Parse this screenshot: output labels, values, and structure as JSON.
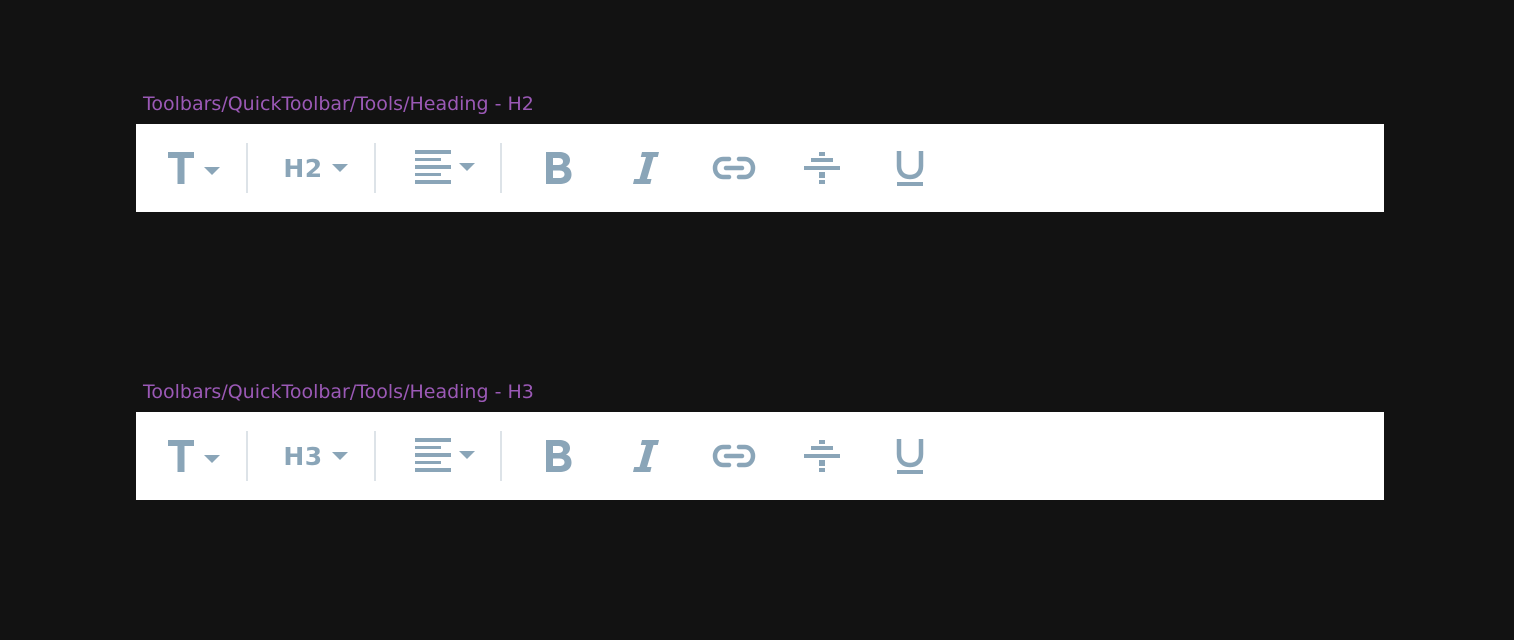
{
  "colors": {
    "background": "#121212",
    "toolbar_bg": "#ffffff",
    "icon": "#8aa5b8",
    "separator": "#dde3e8",
    "frame_label": "#9b59b6"
  },
  "frames": [
    {
      "label": "Toolbars/QuickToolbar/Tools/Heading - H2",
      "heading_value": "H2",
      "tools": [
        "text-type-icon",
        "heading-dropdown",
        "align-left-icon",
        "bold-icon",
        "italic-icon",
        "link-icon",
        "strikethrough-icon",
        "underline-icon"
      ]
    },
    {
      "label": "Toolbars/QuickToolbar/Tools/Heading - H3",
      "heading_value": "H3",
      "tools": [
        "text-type-icon",
        "heading-dropdown",
        "align-left-icon",
        "bold-icon",
        "italic-icon",
        "link-icon",
        "strikethrough-icon",
        "underline-icon"
      ]
    }
  ]
}
